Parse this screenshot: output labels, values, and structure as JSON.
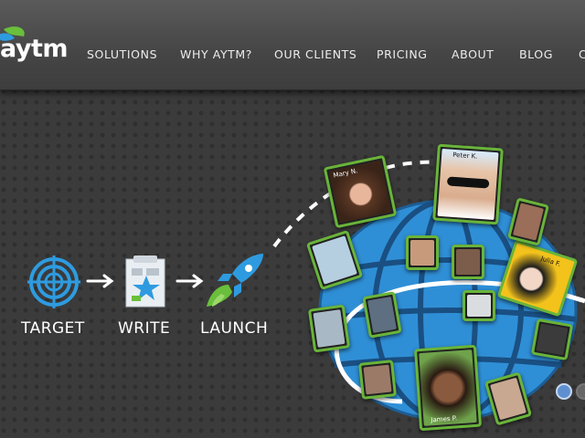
{
  "brand": {
    "logo_text": "aytm"
  },
  "nav": {
    "items": [
      {
        "label": "SOLUTIONS"
      },
      {
        "label": "WHY AYTM?"
      },
      {
        "label": "OUR CLIENTS"
      },
      {
        "label": "PRICING"
      },
      {
        "label": "ABOUT"
      },
      {
        "label": "BLOG"
      },
      {
        "label": "C"
      }
    ]
  },
  "steps": [
    {
      "label": "TARGET",
      "icon": "target-icon"
    },
    {
      "label": "WRITE",
      "icon": "survey-form-icon"
    },
    {
      "label": "LAUNCH",
      "icon": "rocket-icon"
    }
  ],
  "respondents": [
    {
      "name": "Mary N."
    },
    {
      "name": "Peter K."
    },
    {
      "name": "Julia F."
    },
    {
      "name": "James P."
    }
  ],
  "colors": {
    "accent_blue": "#2e9be0",
    "accent_green": "#6abf3c",
    "globe_blue": "#2f8fd6"
  }
}
